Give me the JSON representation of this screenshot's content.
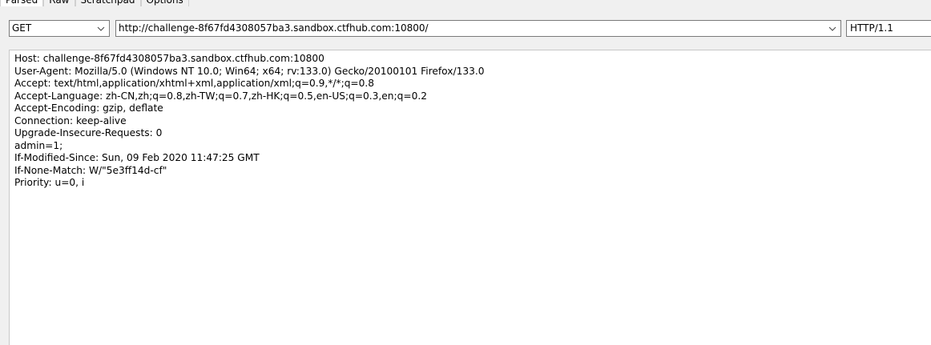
{
  "tabs": [
    {
      "label": "Parsed",
      "active": true
    },
    {
      "label": "Raw",
      "active": false
    },
    {
      "label": "Scratchpad",
      "active": false
    },
    {
      "label": "Options",
      "active": false
    }
  ],
  "request": {
    "method": "GET",
    "url": "http://challenge-8f67fd4308057ba3.sandbox.ctfhub.com:10800/",
    "version": "HTTP/1.1"
  },
  "headers": [
    "Host: challenge-8f67fd4308057ba3.sandbox.ctfhub.com:10800",
    "User-Agent: Mozilla/5.0 (Windows NT 10.0; Win64; x64; rv:133.0) Gecko/20100101 Firefox/133.0",
    "Accept: text/html,application/xhtml+xml,application/xml;q=0.9,*/*;q=0.8",
    "Accept-Language: zh-CN,zh;q=0.8,zh-TW;q=0.7,zh-HK;q=0.5,en-US;q=0.3,en;q=0.2",
    "Accept-Encoding: gzip, deflate",
    "Connection: keep-alive",
    "Upgrade-Insecure-Requests: 0",
    "admin=1;",
    "If-Modified-Since: Sun, 09 Feb 2020 11:47:25 GMT",
    "If-None-Match: W/\"5e3ff14d-cf\"",
    "Priority: u=0, i"
  ],
  "icons": {
    "method_dropdown": "chevron-down-icon",
    "url_dropdown": "chevron-down-icon"
  },
  "colors": {
    "background": "#f0f0f0",
    "field_border": "#7a7a7a",
    "text": "#000000"
  }
}
